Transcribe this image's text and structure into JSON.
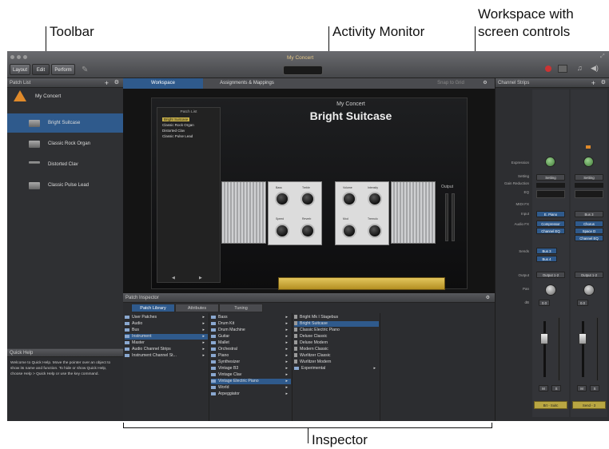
{
  "callouts": {
    "toolbar": "Toolbar",
    "activity_monitor": "Activity Monitor",
    "workspace_line1": "Workspace with",
    "workspace_line2": "screen controls",
    "inspector": "Inspector"
  },
  "toolbar": {
    "buttons": [
      "Layout",
      "Edit",
      "Perform"
    ],
    "concert_title": "My Concert"
  },
  "patch_list": {
    "header": "Patch List",
    "concert": "My Concert",
    "items": [
      "Bright Suitcase",
      "Classic Rock Organ",
      "Distorted Clav",
      "Classic Pulse Lead"
    ]
  },
  "quick_help": {
    "header": "Quick Help",
    "text": "Welcome to Quick Help. Move the pointer over an object to show its name and function. To hide or show Quick Help, choose Help > Quick Help or use the key command."
  },
  "workspace": {
    "tabs": [
      "Workspace",
      "Assignments & Mappings"
    ],
    "snap_label": "Snap to Grid",
    "concert_label": "My Concert",
    "patch_name": "Bright Suitcase",
    "inner_list_header": "Patch List",
    "inner_list": [
      "Bright Suitcase",
      "Classic Rock Organ",
      "Distorted Clav",
      "Classic Pulse Lead"
    ],
    "output_label": "Output",
    "knob_labels": [
      "Bass",
      "Treble",
      "Volume",
      "Intensity",
      "Speed",
      "Reverb",
      "Mod",
      "Tremolo"
    ]
  },
  "inspector": {
    "header": "Patch Inspector",
    "tabs": [
      "Patch Library",
      "Attributes",
      "Tuning"
    ],
    "col1": [
      "User Patches",
      "Audio",
      "Bus",
      "Instrument",
      "Master",
      "Audio Channel Strips",
      "Instrument Channel St..."
    ],
    "col2": [
      "Bass",
      "Drum Kit",
      "Drum Machine",
      "Guitar",
      "Mallet",
      "Orchestral",
      "Piano",
      "Synthesizer",
      "Vintage B3",
      "Vintage Clav",
      "Vintage Electric Piano",
      "World",
      "Arpeggiator"
    ],
    "col3": [
      "Bright Mk I Stagebus",
      "Bright Suitcase",
      "Classic Electric Piano",
      "Deluxe Classic",
      "Deluxe Modern",
      "Modern Classic",
      "Wurlitzer Classic",
      "Wurlitzer Modern",
      "Experimental"
    ]
  },
  "channel_strips": {
    "header": "Channel Strips",
    "row_labels": [
      "Expression",
      "Setting",
      "Gain Reduction",
      "EQ",
      "MIDI FX",
      "Input",
      "Audio FX",
      "Sends",
      "Output",
      "Pan",
      "dB"
    ],
    "strip1": {
      "setting": "Setting",
      "input": "E. Piano",
      "fx": [
        "Compressor",
        "Channel EQ"
      ],
      "sends": [
        "Bus 3",
        "Bus 4"
      ],
      "output": "Output 1-2",
      "db": "0.0",
      "name": "Brt - Suitc"
    },
    "strip2": {
      "setting": "Setting",
      "input": "Bus 3",
      "fx": [
        "Chorus",
        "Space D",
        "Channel EQ"
      ],
      "output": "Output 1-2",
      "db": "0.0",
      "name": "Send - 3"
    },
    "mute": "M",
    "solo": "S"
  }
}
